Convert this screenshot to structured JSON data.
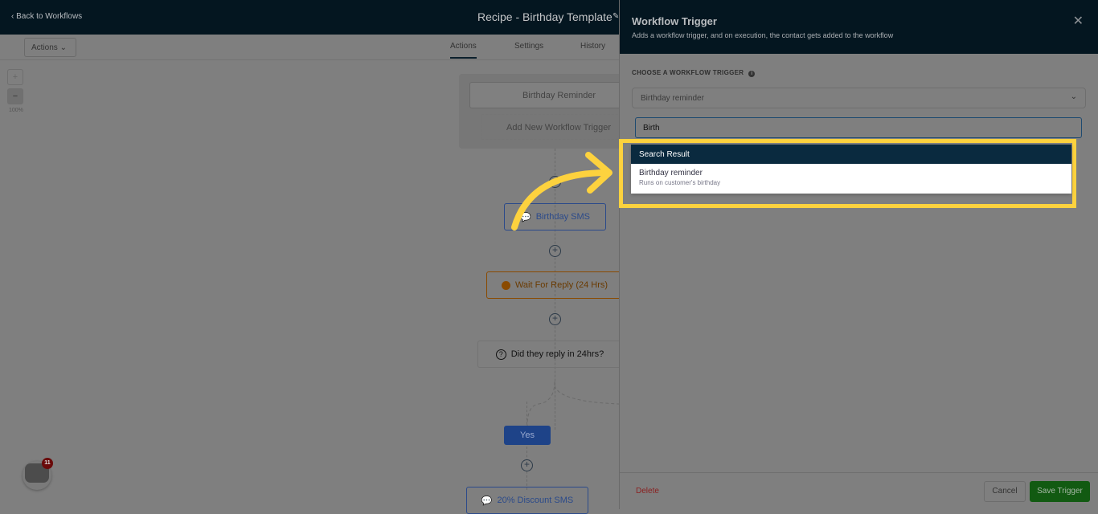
{
  "topbar": {
    "back_label": "Back to Workflows",
    "title": "Recipe - Birthday Template"
  },
  "toolbar": {
    "actions_label": "Actions",
    "tabs": [
      "Actions",
      "Settings",
      "History"
    ],
    "zoom_level": "100%",
    "zoom_in": "+",
    "zoom_out": "−"
  },
  "canvas": {
    "trigger": "Birthday Reminder",
    "add_trigger": "Add New Workflow Trigger",
    "nodes": {
      "sms": "Birthday SMS",
      "wait": "Wait For Reply (24 Hrs)",
      "condition": "Did they reply in 24hrs?",
      "yes": "Yes",
      "discount": "20% Discount SMS"
    }
  },
  "chat_widget": {
    "badge_count": "11"
  },
  "panel": {
    "title": "Workflow Trigger",
    "subtitle": "Adds a workflow trigger, and on execution, the contact gets added to the workflow",
    "section_label": "CHOOSE A WORKFLOW TRIGGER",
    "selected_trigger": "Birthday reminder",
    "search_value": "Birth",
    "results_header": "Search Result",
    "results": [
      {
        "name": "Birthday reminder",
        "description": "Runs on customer's birthday"
      }
    ],
    "delete_label": "Delete",
    "cancel_label": "Cancel",
    "save_label": "Save Trigger"
  },
  "colors": {
    "highlight": "#fdd23e",
    "header": "#041620",
    "save": "#125a12",
    "sms_node": "#2b4a8a",
    "wait_node": "#8a4a00"
  }
}
